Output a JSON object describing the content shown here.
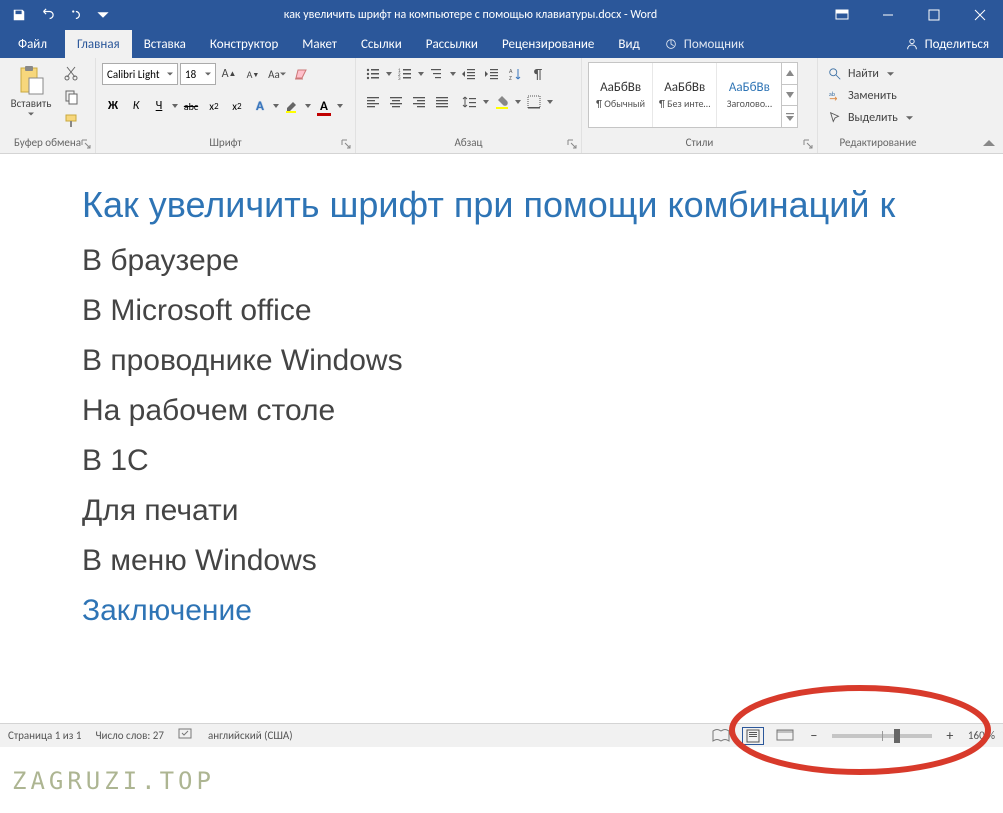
{
  "title": {
    "document": "как увеличить шрифт на компьютере с помощью клавиатуры.docx",
    "separator": " - ",
    "app": "Word"
  },
  "tabs": {
    "file": "Файл",
    "home": "Главная",
    "insert": "Вставка",
    "design": "Конструктор",
    "layout": "Макет",
    "references": "Ссылки",
    "mailings": "Рассылки",
    "review": "Рецензирование",
    "view": "Вид",
    "tell_me": "Помощник",
    "share": "Поделиться"
  },
  "ribbon": {
    "clipboard": {
      "paste": "Вставить",
      "label": "Буфер обмена"
    },
    "font": {
      "name": "Calibri Light",
      "size": "18",
      "label": "Шрифт",
      "bold": "Ж",
      "italic": "К",
      "underline": "Ч",
      "strike": "abc",
      "sub": "x₂",
      "sup": "x²"
    },
    "paragraph": {
      "label": "Абзац"
    },
    "styles": {
      "label": "Стили",
      "preview": "АаБбВв",
      "items": [
        "¶ Обычный",
        "¶ Без инте…",
        "Заголово…"
      ]
    },
    "editing": {
      "label": "Редактирование",
      "find": "Найти",
      "replace": "Заменить",
      "select": "Выделить"
    }
  },
  "document": {
    "h1": "Как увеличить шрифт при помощи комбинаций к",
    "sections": [
      "В браузере",
      "В Microsoft office",
      "В проводнике Windows",
      "На рабочем столе",
      "В 1С",
      "Для печати",
      "В меню Windows"
    ],
    "conclusion": "Заключение"
  },
  "status": {
    "page": "Страница 1 из 1",
    "words": "Число слов: 27",
    "language": "английский (США)",
    "zoom": "160 %",
    "zoom_thumb_pct": 62
  },
  "watermark": "ZAGRUZI.TOP"
}
